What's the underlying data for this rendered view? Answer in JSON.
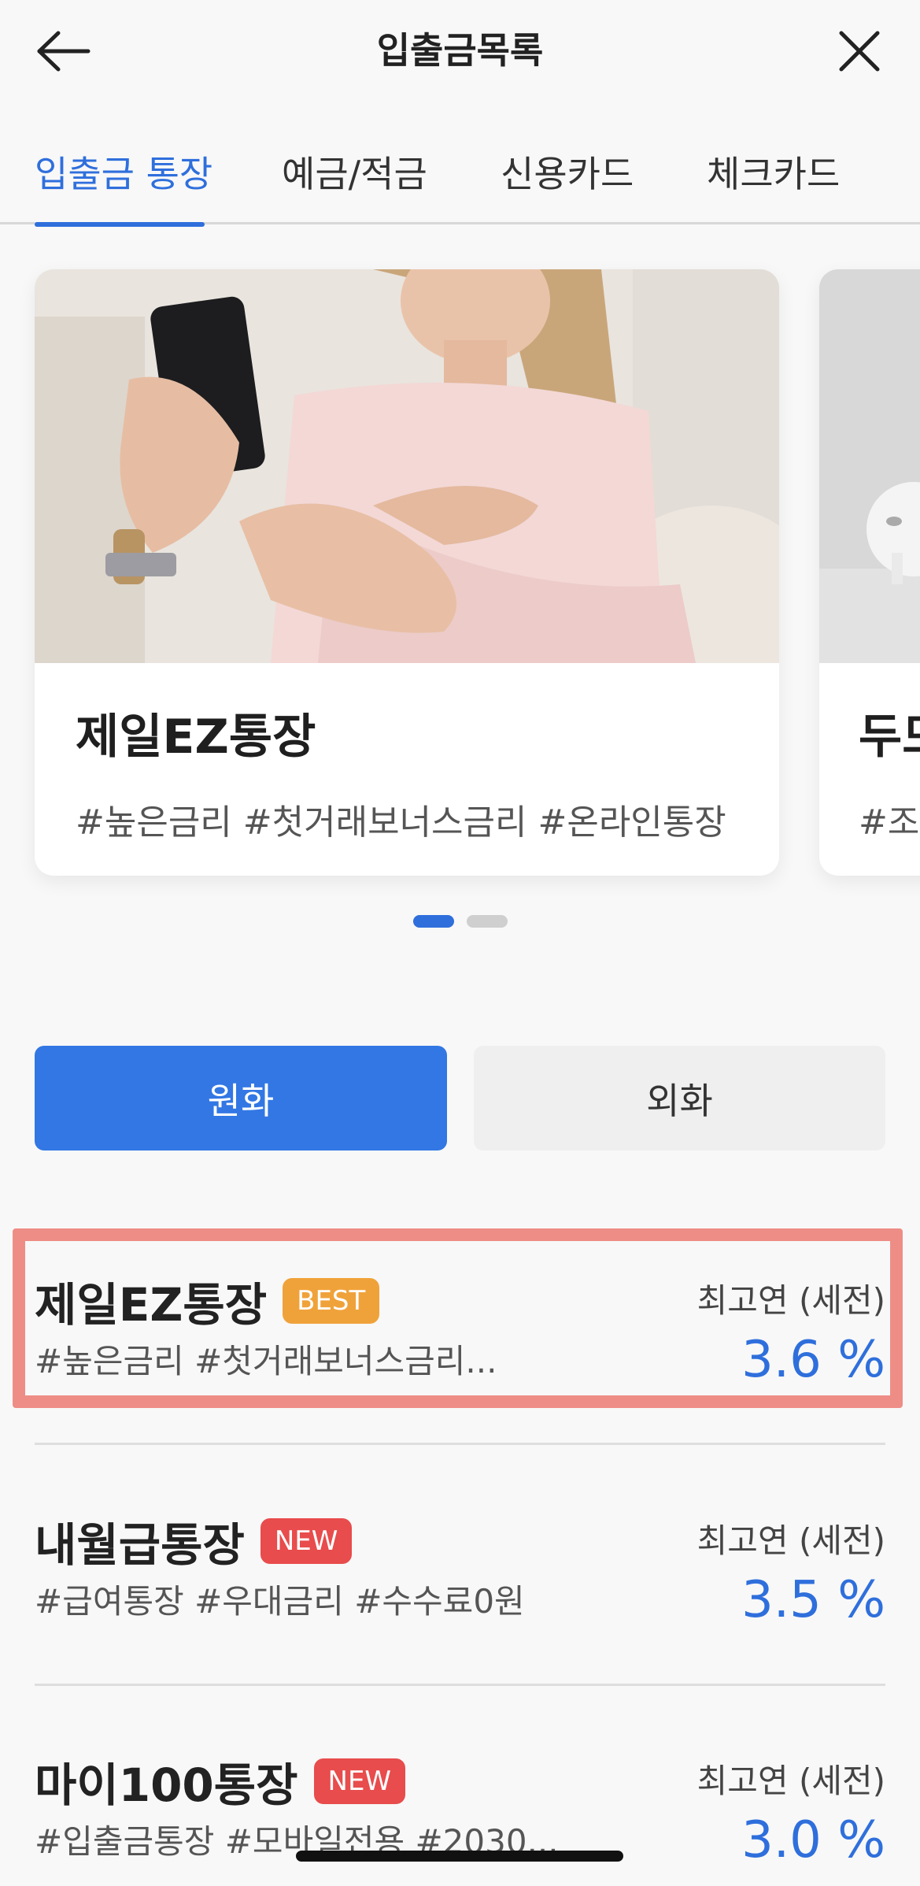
{
  "header": {
    "title": "입출금목록",
    "back_icon": "arrow-left-icon",
    "close_icon": "close-icon"
  },
  "tabs": [
    {
      "label": "입출금 통장",
      "active": true
    },
    {
      "label": "예금/적금",
      "active": false
    },
    {
      "label": "신용카드",
      "active": false
    },
    {
      "label": "체크카드",
      "active": false
    }
  ],
  "carousel": {
    "cards": [
      {
        "title": "제일EZ통장",
        "tags": "#높은금리 #첫거래보너스금리 #온라인통장"
      },
      {
        "title": "두모",
        "tags": "#조"
      }
    ],
    "pages": 2,
    "current_page": 1
  },
  "currency_toggle": {
    "krw_label": "원화",
    "fx_label": "외화",
    "selected": "원화"
  },
  "products": [
    {
      "name": "제일EZ통장",
      "badge": "BEST",
      "tags": "#높은금리 #첫거래보너스금리...",
      "rate_label": "최고연 (세전)",
      "rate": "3.6 %"
    },
    {
      "name": "내월급통장",
      "badge": "NEW",
      "tags": "#급여통장 #우대금리 #수수료0원",
      "rate_label": "최고연 (세전)",
      "rate": "3.5 %"
    },
    {
      "name": "마이100통장",
      "badge": "NEW",
      "tags": "#입출금통장 #모바일전용 #2030...",
      "rate_label": "최고연 (세전)",
      "rate": "3.0 %"
    }
  ],
  "colors": {
    "accent": "#2f6fdc",
    "toggle_active": "#3277e4",
    "badge_best": "#f0a23a",
    "badge_new": "#e84c4c",
    "highlight": "#ee8d86"
  }
}
